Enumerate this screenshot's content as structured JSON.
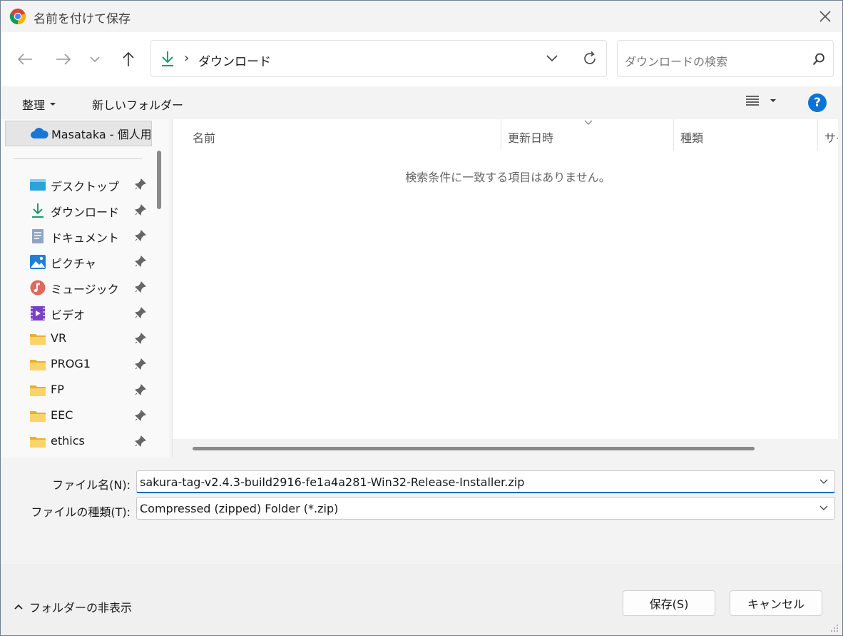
{
  "window": {
    "title": "名前を付けて保存"
  },
  "address": {
    "current": "ダウンロード"
  },
  "search": {
    "placeholder": "ダウンロードの検索"
  },
  "commands": {
    "organize": "整理",
    "new_folder": "新しいフォルダー"
  },
  "nav": {
    "onedrive": "Masataka - 個人用",
    "items": [
      {
        "label": "デスクトップ",
        "icon": "desktop-icon"
      },
      {
        "label": "ダウンロード",
        "icon": "download-icon"
      },
      {
        "label": "ドキュメント",
        "icon": "document-icon"
      },
      {
        "label": "ピクチャ",
        "icon": "pictures-icon"
      },
      {
        "label": "ミュージック",
        "icon": "music-icon"
      },
      {
        "label": "ビデオ",
        "icon": "video-icon"
      },
      {
        "label": "VR",
        "icon": "folder-icon"
      },
      {
        "label": "PROG1",
        "icon": "folder-icon"
      },
      {
        "label": "FP",
        "icon": "folder-icon"
      },
      {
        "label": "EEC",
        "icon": "folder-icon"
      },
      {
        "label": "ethics",
        "icon": "folder-icon"
      }
    ]
  },
  "columns": {
    "name": "名前",
    "modified": "更新日時",
    "type": "種類",
    "size": "サイ"
  },
  "empty_message": "検索条件に一致する項目はありません。",
  "fields": {
    "filename_label": "ファイル名(N):",
    "filename_value": "sakura-tag-v2.4.3-build2916-fe1a4a281-Win32-Release-Installer.zip",
    "filetype_label": "ファイルの種類(T):",
    "filetype_value": "Compressed (zipped) Folder (*.zip)"
  },
  "footer": {
    "hide_folders": "フォルダーの非表示",
    "save": "保存(S)",
    "cancel": "キャンセル"
  },
  "colors": {
    "accent": "#0067c0",
    "help": "#0a74d6",
    "download": "#1a9e6e",
    "folder": "#f5c343"
  }
}
